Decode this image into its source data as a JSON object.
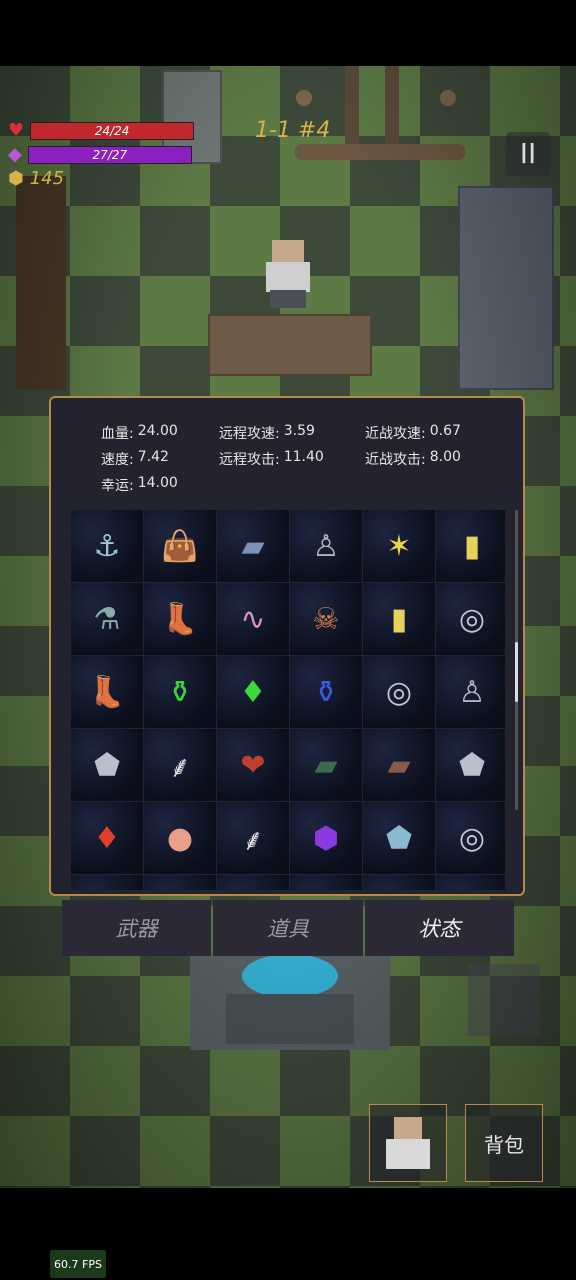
{
  "hud": {
    "hp_text": "24/24",
    "hp_fraction": 1.0,
    "mp_text": "27/27",
    "mp_fraction": 1.0,
    "gold": "145",
    "stage": "1-1 #4",
    "pause_label": "II",
    "colors": {
      "hp": "#c1272d",
      "mp": "#8b1fbf",
      "gold": "#d8b24a"
    },
    "icons": {
      "hp": "heart-icon",
      "mp": "mana-gem-icon",
      "gold": "gold-coin-icon"
    }
  },
  "stats": {
    "rows": [
      [
        {
          "label": "血量:",
          "value": "24.00"
        },
        {
          "label": "远程攻速:",
          "value": "3.59"
        },
        {
          "label": "近战攻速:",
          "value": "0.67"
        }
      ],
      [
        {
          "label": "速度:",
          "value": "7.42"
        },
        {
          "label": "远程攻击:",
          "value": "11.40"
        },
        {
          "label": "近战攻击:",
          "value": "8.00"
        }
      ],
      [
        {
          "label": "幸运:",
          "value": "14.00"
        }
      ]
    ]
  },
  "inventory": {
    "items": [
      "anchor-hook-icon",
      "sack-icon",
      "book-blue-icon",
      "cloak-icon",
      "star-charm-icon",
      "yellow-card-icon",
      "flask-small-icon",
      "boots-icon",
      "worm-icon",
      "spiky-skull-icon",
      "yellow-card-icon",
      "silver-ring-icon",
      "boots-icon",
      "green-potion-icon",
      "green-crystal-icon",
      "blue-potion-icon",
      "silver-ring-icon",
      "cloak-icon",
      "silver-ore-icon",
      "white-feather-icon",
      "red-heart-relic-icon",
      "green-book-icon",
      "brown-book-icon",
      "silver-ore-icon",
      "red-crystal-icon",
      "apple-icon",
      "white-feather-icon",
      "purple-gem-icon",
      "blue-ore-icon",
      "silver-ring-icon",
      "slot-empty-icon",
      "slot-empty-icon",
      "slot-empty-icon",
      "slot-empty-icon",
      "slot-empty-icon",
      "slot-empty-icon"
    ],
    "scroll_position": 0.55
  },
  "tabs": [
    {
      "label": "武器",
      "active": false
    },
    {
      "label": "道具",
      "active": false
    },
    {
      "label": "状态",
      "active": true
    }
  ],
  "buttons": {
    "bag": "背包"
  },
  "fps": "60.7 FPS"
}
